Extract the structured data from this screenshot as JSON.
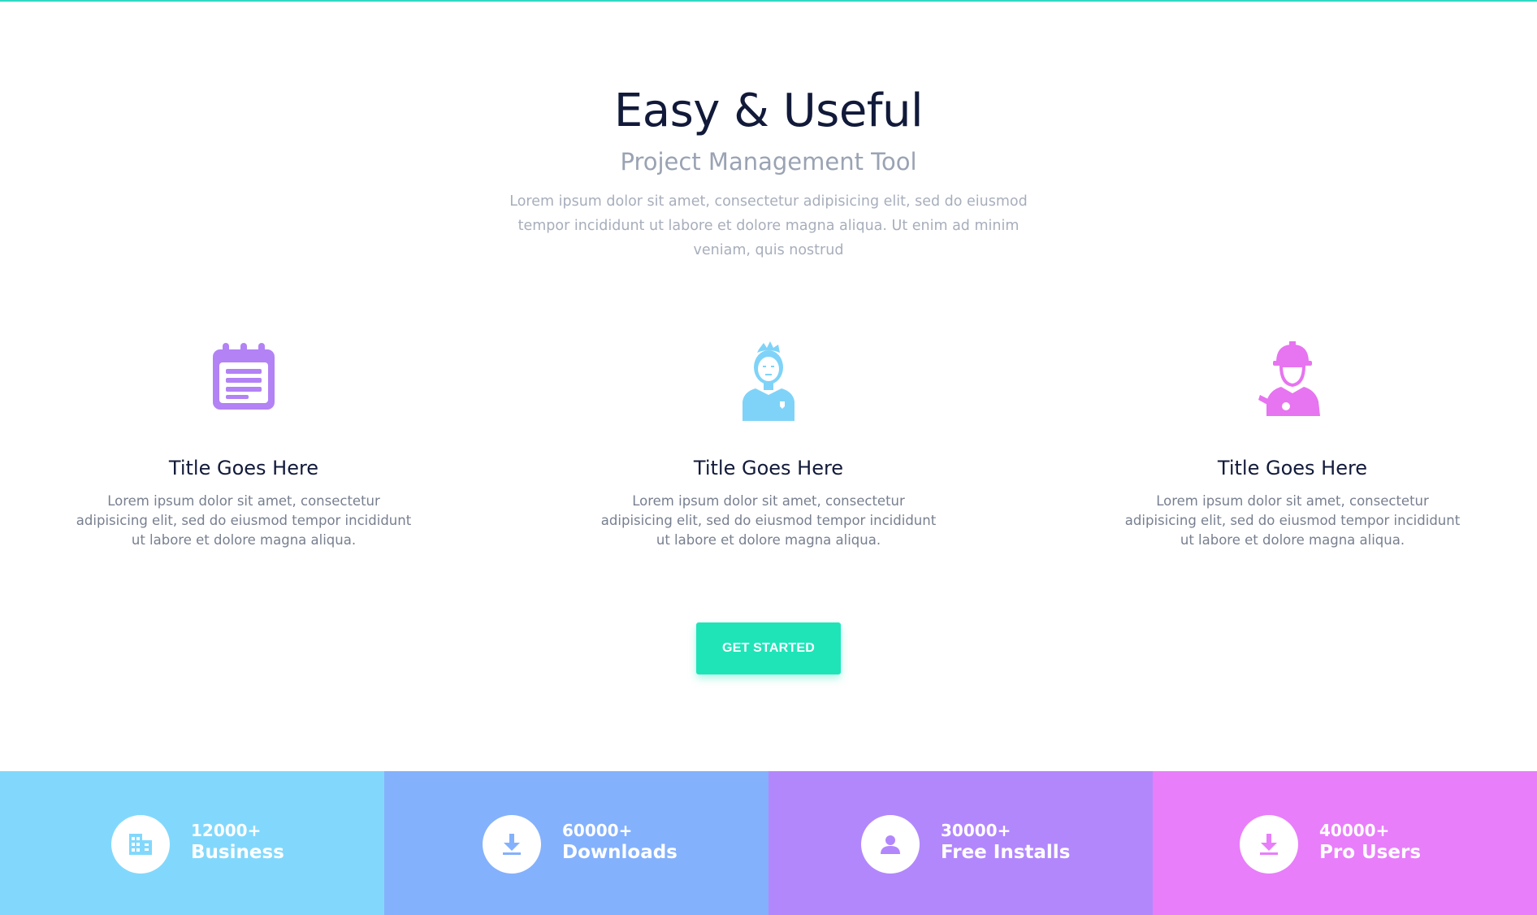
{
  "hero": {
    "title": "Easy & Useful",
    "subtitle": "Project Management Tool",
    "description": "Lorem ipsum dolor sit amet, consectetur adipisicing elit, sed do eiusmod tempor incididunt ut labore et dolore magna aliqua. Ut enim ad minim veniam, quis nostrud"
  },
  "features": [
    {
      "icon": "calendar-icon",
      "title": "Title Goes Here",
      "description": "Lorem ipsum dolor sit amet, consectetur adipisicing elit, sed do eiusmod tempor incididunt ut labore et dolore magna aliqua."
    },
    {
      "icon": "person-icon",
      "title": "Title Goes Here",
      "description": "Lorem ipsum dolor sit amet, consectetur adipisicing elit, sed do eiusmod tempor incididunt ut labore et dolore magna aliqua."
    },
    {
      "icon": "worker-icon",
      "title": "Title Goes Here",
      "description": "Lorem ipsum dolor sit amet, consectetur adipisicing elit, sed do eiusmod tempor incididunt ut labore et dolore magna aliqua."
    }
  ],
  "cta": {
    "label": "GET STARTED"
  },
  "stats": [
    {
      "icon": "building-icon",
      "number": "12000+",
      "label": "Business",
      "color": "#82d8fc"
    },
    {
      "icon": "download-icon",
      "number": "60000+",
      "label": "Downloads",
      "color": "#84b1fc"
    },
    {
      "icon": "user-icon",
      "number": "30000+",
      "label": "Free Installs",
      "color": "#b287fc"
    },
    {
      "icon": "download-icon",
      "number": "40000+",
      "label": "Pro Users",
      "color": "#e87efa"
    }
  ],
  "colors": {
    "accent": "#1fe4b8",
    "feature_icon_1": "#b382f5",
    "feature_icon_2": "#7fd3f8",
    "feature_icon_3": "#e774f0"
  }
}
